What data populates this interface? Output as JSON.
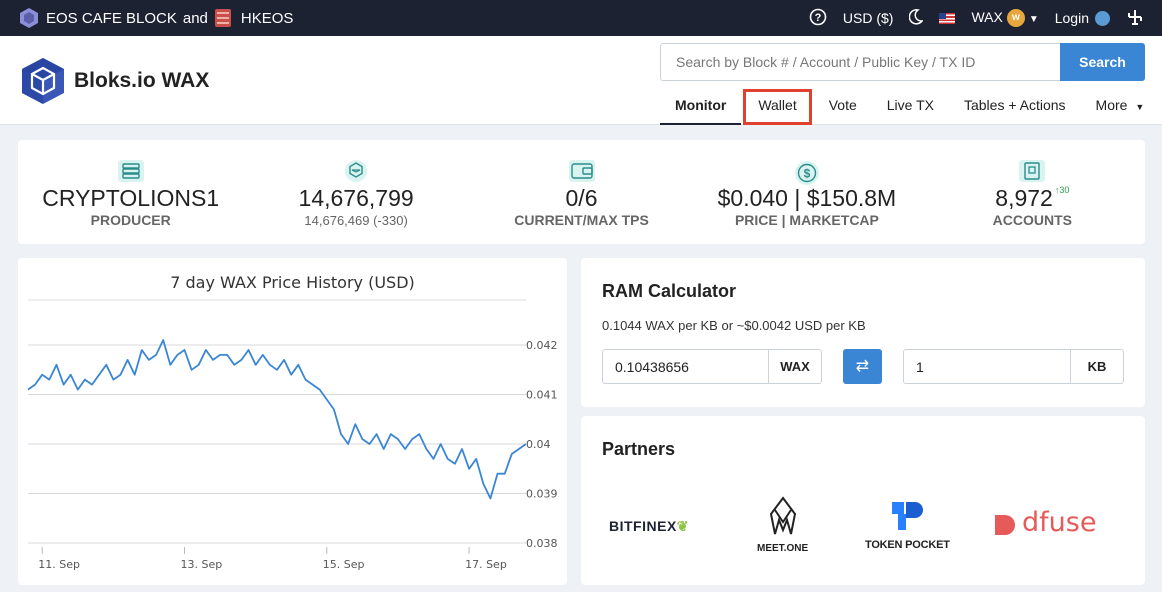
{
  "topbar": {
    "producer_left": "EOS CAFE BLOCK",
    "and": "and",
    "producer_right": "HKEOS",
    "currency": "USD ($)",
    "network": "WAX",
    "login": "Login"
  },
  "header": {
    "logo_text": "Bloks.io WAX",
    "search_placeholder": "Search by Block # / Account / Public Key / TX ID",
    "search_button": "Search",
    "nav": [
      "Monitor",
      "Wallet",
      "Vote",
      "Live TX",
      "Tables + Actions",
      "More"
    ]
  },
  "stats": [
    {
      "value": "CRYPTOLIONS1",
      "label": "PRODUCER"
    },
    {
      "value": "14,676,799",
      "sub": "14,676,469 (-330)"
    },
    {
      "value": "0/6",
      "label": "CURRENT/MAX TPS"
    },
    {
      "value": "$0.040 | $150.8M",
      "label": "PRICE | MARKETCAP"
    },
    {
      "value": "8,972",
      "delta": "↑30",
      "label": "ACCOUNTS"
    }
  ],
  "chart_data": {
    "type": "line",
    "title": "7 day WAX Price History (USD)",
    "xticks": [
      "11. Sep",
      "13. Sep",
      "15. Sep",
      "17. Sep"
    ],
    "yticks": [
      "0.038",
      "0.039",
      "0.04",
      "0.041",
      "0.042"
    ],
    "ylim": [
      0.038,
      0.0422
    ],
    "xlim": [
      0,
      7
    ],
    "series": [
      {
        "color": "#3a86d4",
        "x": [
          0,
          0.1,
          0.2,
          0.3,
          0.4,
          0.5,
          0.6,
          0.7,
          0.8,
          0.9,
          1.0,
          1.1,
          1.2,
          1.3,
          1.4,
          1.5,
          1.6,
          1.7,
          1.8,
          1.9,
          2.0,
          2.1,
          2.2,
          2.3,
          2.4,
          2.5,
          2.6,
          2.7,
          2.8,
          2.9,
          3.0,
          3.1,
          3.2,
          3.3,
          3.4,
          3.5,
          3.6,
          3.7,
          3.8,
          3.9,
          4.0,
          4.1,
          4.2,
          4.3,
          4.4,
          4.5,
          4.6,
          4.7,
          4.8,
          4.9,
          5.0,
          5.1,
          5.2,
          5.3,
          5.4,
          5.5,
          5.6,
          5.7,
          5.8,
          5.9,
          6.0,
          6.1,
          6.2,
          6.3,
          6.4,
          6.5,
          6.6,
          6.7,
          6.8,
          6.9,
          7.0
        ],
        "values": [
          0.0411,
          0.0412,
          0.0414,
          0.0413,
          0.0416,
          0.0412,
          0.0414,
          0.0411,
          0.0413,
          0.0412,
          0.0414,
          0.0416,
          0.0413,
          0.0414,
          0.0417,
          0.0414,
          0.0419,
          0.0417,
          0.0418,
          0.0421,
          0.0416,
          0.0418,
          0.0419,
          0.0415,
          0.0416,
          0.0419,
          0.0417,
          0.0418,
          0.0418,
          0.0416,
          0.0417,
          0.0419,
          0.0416,
          0.0418,
          0.0416,
          0.0415,
          0.0417,
          0.0414,
          0.0416,
          0.0413,
          0.0412,
          0.0411,
          0.0409,
          0.0407,
          0.0402,
          0.04,
          0.0404,
          0.0401,
          0.04,
          0.0402,
          0.0399,
          0.0402,
          0.0401,
          0.0399,
          0.0401,
          0.0402,
          0.0399,
          0.0397,
          0.04,
          0.0397,
          0.0396,
          0.0399,
          0.0395,
          0.0397,
          0.0392,
          0.0389,
          0.0394,
          0.0394,
          0.0398,
          0.0399,
          0.04
        ]
      }
    ]
  },
  "ram": {
    "title": "RAM Calculator",
    "rate": "0.1044 WAX per KB or ~$0.0042 USD per KB",
    "wax_value": "0.10438656",
    "wax_unit": "WAX",
    "swap_icon": "⇄",
    "kb_value": "1",
    "kb_unit": "KB"
  },
  "partners": {
    "title": "Partners",
    "items": [
      "BITFINEX",
      "MEET.ONE",
      "TOKEN POCKET",
      "dfuse"
    ]
  }
}
